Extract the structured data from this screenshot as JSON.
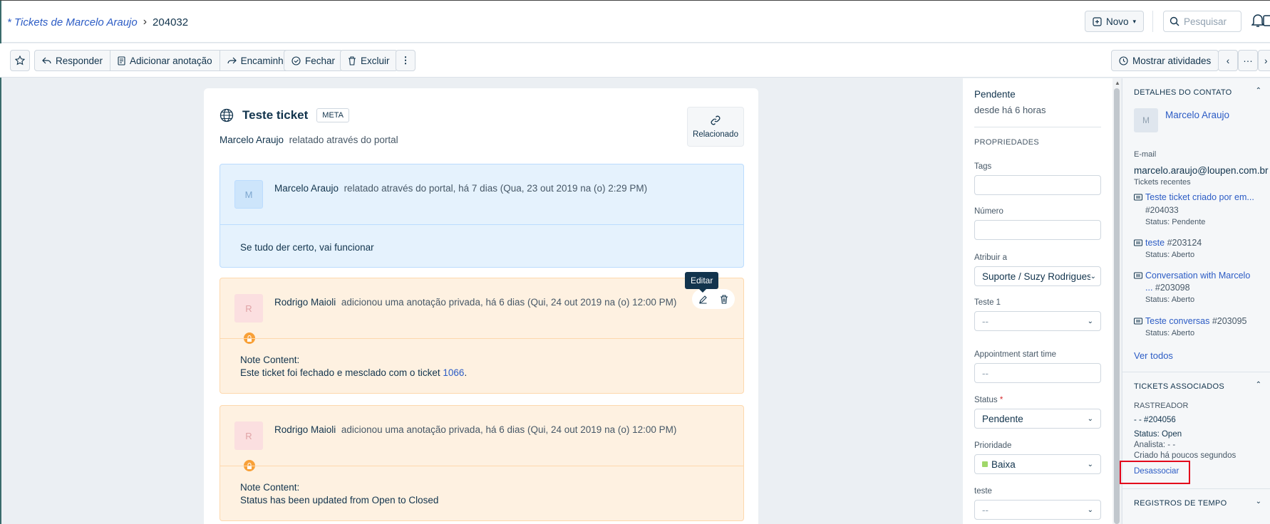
{
  "header": {
    "breadcrumb_link": "* Tickets de Marcelo Araujo",
    "breadcrumb_current": "204032",
    "novo_label": "Novo",
    "search_placeholder": "Pesquisar"
  },
  "toolbar": {
    "responder": "Responder",
    "adicionar_anotacao": "Adicionar anotação",
    "encaminhar": "Encaminhar",
    "fechar": "Fechar",
    "excluir": "Excluir",
    "mostrar_atividades": "Mostrar atividades"
  },
  "ticket": {
    "title": "Teste ticket",
    "badge": "META",
    "reporter": "Marcelo Araujo",
    "reported_via": "relatado através do portal",
    "related_label": "Relacionado"
  },
  "messages": [
    {
      "avatar": "M",
      "author": "Marcelo Araujo",
      "meta": "relatado através do portal, há 7 dias (Qua, 23 out 2019 na (o) 2:29 PM)",
      "body": "Se tudo der certo, vai funcionar"
    },
    {
      "avatar": "R",
      "author": "Rodrigo Maioli",
      "meta": "adicionou uma anotação privada, há 6 dias (Qui, 24 out 2019 na (o) 12:00 PM)",
      "body_line1": "Note Content:",
      "body_line2_prefix": "Este ticket foi fechado e mesclado com o ticket ",
      "body_link": "1066",
      "body_line2_suffix": "."
    },
    {
      "avatar": "R",
      "author": "Rodrigo Maioli",
      "meta": "adicionou uma anotação privada, há 6 dias (Qui, 24 out 2019 na (o) 12:00 PM)",
      "body_line1": "Note Content:",
      "body_line2": "Status has been updated from Open to Closed"
    }
  ],
  "tooltip": "Editar",
  "properties": {
    "status_title": "Pendente",
    "since": "desde há 6 horas",
    "heading": "PROPRIEDADES",
    "tags_label": "Tags",
    "numero_label": "Número",
    "atribuir_label": "Atribuir a",
    "atribuir_value": "Suporte / Suzy Rodrigues",
    "teste1_label": "Teste 1",
    "teste1_value": "--",
    "appointment_label": "Appointment start time",
    "appointment_value": "--",
    "status_label": "Status",
    "status_value": "Pendente",
    "prioridade_label": "Prioridade",
    "prioridade_value": "Baixa",
    "prioridade_color": "#a0d76a",
    "teste_label": "teste",
    "teste_value": "--"
  },
  "contact": {
    "section": "DETALHES DO CONTATO",
    "avatar": "M",
    "name": "Marcelo Araujo",
    "email_label": "E-mail",
    "email": "marcelo.araujo@loupen.com.br",
    "recent_label": "Tickets recentes",
    "recent": [
      {
        "title": "Teste ticket criado por em...",
        "num": "#204033",
        "status": "Status: Pendente"
      },
      {
        "title": "teste",
        "num": "#203124",
        "status": "Status: Aberto"
      },
      {
        "title": "Conversation with Marcelo",
        "title2": "...",
        "num": "#203098",
        "status": "Status: Aberto"
      },
      {
        "title": "Teste conversas",
        "num": "#203095",
        "status": "Status: Aberto"
      }
    ],
    "ver_todos": "Ver todos"
  },
  "associated": {
    "section": "TICKETS ASSOCIADOS",
    "type": "RASTREADOR",
    "ticket": "- - #204056",
    "status": "Status: Open",
    "analista": "Analista: - -",
    "criado": "Criado há poucos segundos",
    "desassociar": "Desassociar"
  },
  "time_logs": {
    "section": "REGISTROS DE TEMPO"
  }
}
